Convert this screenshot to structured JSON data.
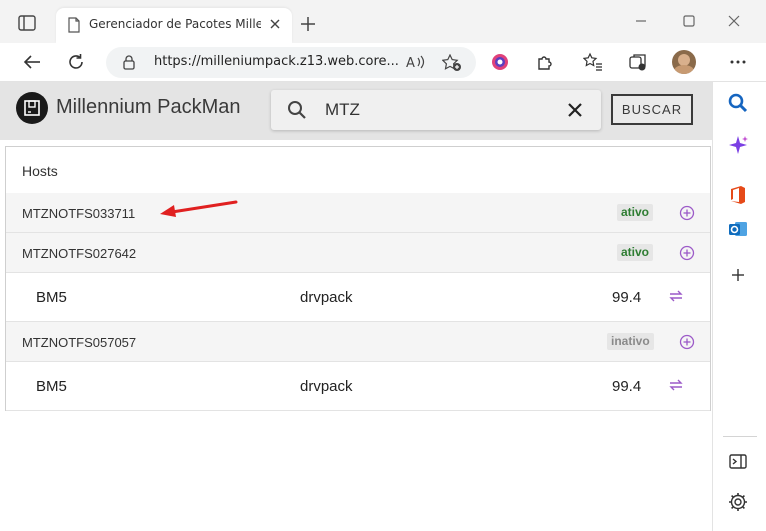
{
  "browser": {
    "tab_title": "Gerenciador de Pacotes Millennium",
    "url": "https://milleniumpack.z13.web.core...."
  },
  "app": {
    "title": "Millennium PackMan",
    "search_value": "MTZ",
    "search_button": "BUSCAR"
  },
  "hosts": {
    "heading": "Hosts",
    "items": [
      {
        "name": "MTZNOTFS033711",
        "status": "ativo",
        "packages": []
      },
      {
        "name": "MTZNOTFS027642",
        "status": "ativo",
        "packages": [
          {
            "name": "BM5",
            "type": "drvpack",
            "version": "99.4"
          }
        ]
      },
      {
        "name": "MTZNOTFS057057",
        "status": "inativo",
        "packages": [
          {
            "name": "BM5",
            "type": "drvpack",
            "version": "99.4"
          }
        ]
      }
    ]
  },
  "colors": {
    "accent_purple": "#9c5ac8",
    "active_green": "#2e7d32",
    "inactive_gray": "#8a8a8a",
    "annotation_red": "#e02020"
  }
}
